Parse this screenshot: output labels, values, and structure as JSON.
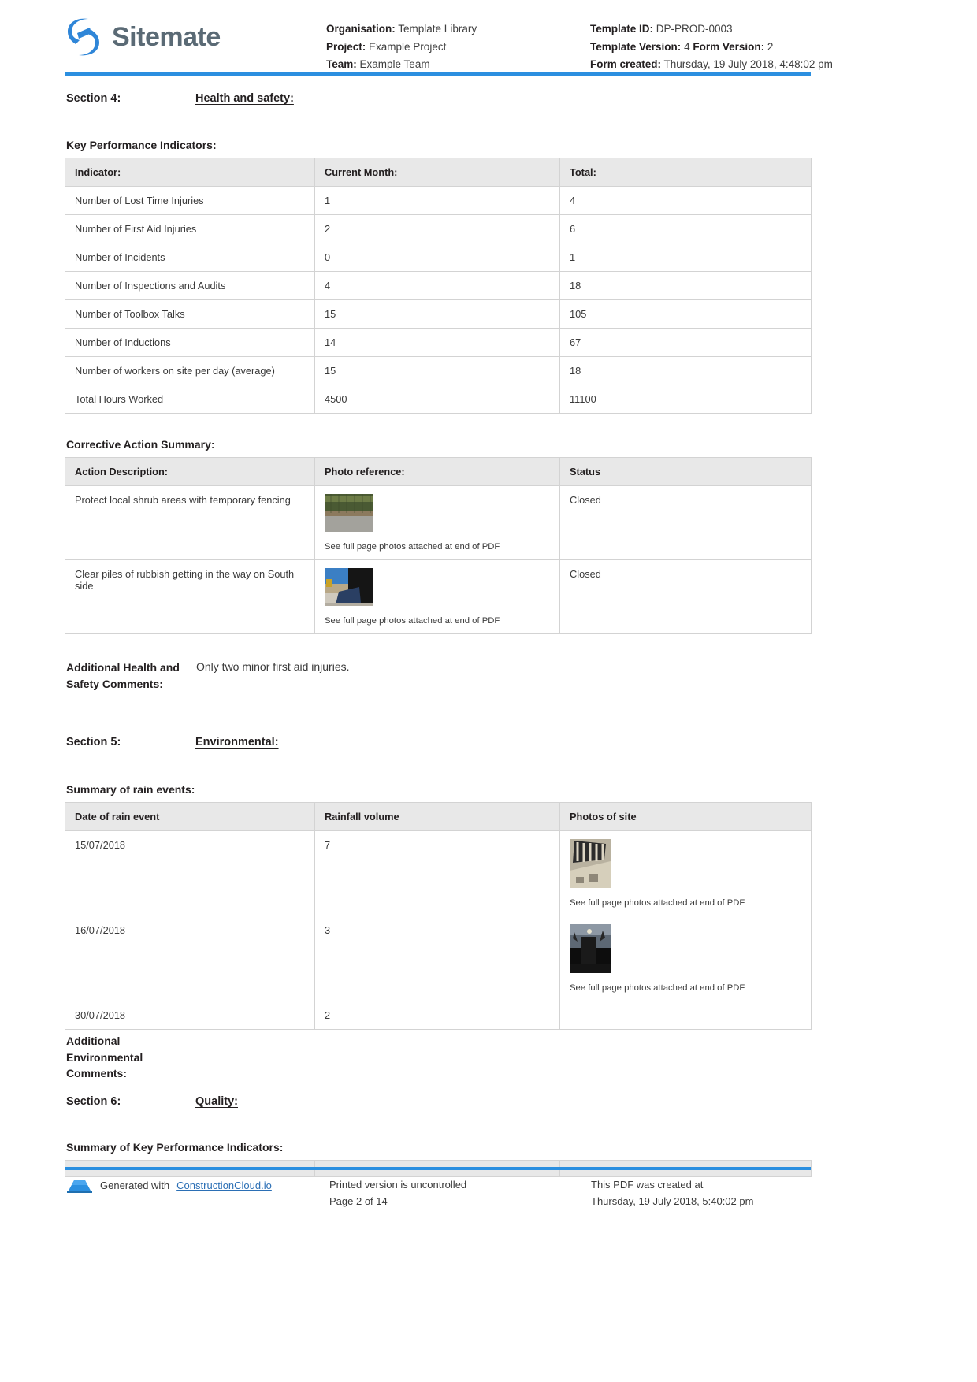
{
  "brand": {
    "name": "Sitemate",
    "logo_icon": "sitemate-logo-icon",
    "accent_color": "#2b8fe0"
  },
  "header": {
    "left": [
      {
        "label": "Organisation:",
        "value": "Template Library"
      },
      {
        "label": "Project:",
        "value": "Example Project"
      },
      {
        "label": "Team:",
        "value": "Example Team"
      }
    ],
    "right": [
      {
        "label": "Template ID:",
        "value": "DP-PROD-0003"
      },
      {
        "label": "Template Version:",
        "value": "4",
        "label2": "Form Version:",
        "value2": "2"
      },
      {
        "label": "Form created:",
        "value": "Thursday, 19 July 2018, 4:48:02 pm"
      }
    ]
  },
  "section4": {
    "label": "Section 4:",
    "name": "Health and safety:",
    "kpi": {
      "title": "Key Performance Indicators:",
      "columns": [
        "Indicator:",
        "Current Month:",
        "Total:"
      ],
      "rows": [
        [
          "Number of Lost Time Injuries",
          "1",
          "4"
        ],
        [
          "Number of First Aid Injuries",
          "2",
          "6"
        ],
        [
          "Number of Incidents",
          "0",
          "1"
        ],
        [
          "Number of Inspections and Audits",
          "4",
          "18"
        ],
        [
          "Number of Toolbox Talks",
          "15",
          "105"
        ],
        [
          "Number of Inductions",
          "14",
          "67"
        ],
        [
          "Number of workers on site per day (average)",
          "15",
          "18"
        ],
        [
          "Total Hours Worked",
          "4500",
          "11100"
        ]
      ]
    },
    "corrective": {
      "title": "Corrective Action Summary:",
      "columns": [
        "Action Description:",
        "Photo reference:",
        "Status"
      ],
      "photo_caption": "See full page photos attached at end of PDF",
      "rows": [
        {
          "description": "Protect local shrub areas with temporary fencing",
          "photo": "fence-shrub-photo",
          "status": "Closed"
        },
        {
          "description": "Clear piles of rubbish getting in the way on South side",
          "photo": "rubbish-pile-photo",
          "status": "Closed"
        }
      ]
    },
    "comments": {
      "label": "Additional Health and Safety Comments:",
      "value": "Only two minor first aid injuries."
    }
  },
  "section5": {
    "label": "Section 5:",
    "name": "Environmental:",
    "rain": {
      "title": "Summary of rain events:",
      "columns": [
        "Date of rain event",
        "Rainfall volume",
        "Photos of site"
      ],
      "photo_caption": "See full page photos attached at end of PDF",
      "rows": [
        {
          "date": "15/07/2018",
          "volume": "7",
          "photo": "stadium-roof-photo"
        },
        {
          "date": "16/07/2018",
          "volume": "3",
          "photo": "night-site-photo"
        },
        {
          "date": "30/07/2018",
          "volume": "2",
          "photo": ""
        }
      ]
    },
    "comments": {
      "label": "Additional Environmental Comments:",
      "value": ""
    }
  },
  "section6": {
    "label": "Section 6:",
    "name": "Quality:",
    "kpi_title": "Summary of Key Performance Indicators:"
  },
  "footer": {
    "generated_prefix": "Generated with",
    "generated_link": "ConstructionCloud.io",
    "icon": "constructioncloud-icon",
    "middle_line1": "Printed version is uncontrolled",
    "middle_line2": "Page 2 of 14",
    "right_line1": "This PDF was created at",
    "right_line2": "Thursday, 19 July 2018, 5:40:02 pm"
  }
}
